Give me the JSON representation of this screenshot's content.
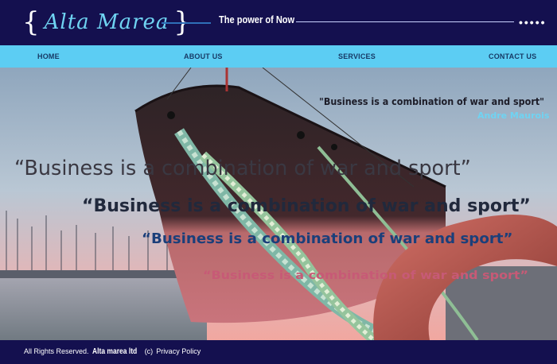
{
  "brand": {
    "brace_open": "{",
    "logo": "Alta Marea",
    "brace_close": "}",
    "tagline": "The power of Now",
    "dots": "•••••"
  },
  "nav": {
    "items": [
      {
        "label": "HOME"
      },
      {
        "label": "ABOUT US"
      },
      {
        "label": "SERVICES"
      },
      {
        "label": "CONTACT US"
      }
    ]
  },
  "hero": {
    "quote_small": "\"Business is a combination of war and sport\"",
    "author": "Andre Maurois",
    "quotes": [
      "“Business is a combination of war and sport”",
      "“Business is a combination of war and sport”",
      "“Business is a combination of war and sport”",
      "“Business is a combination of war and sport”"
    ]
  },
  "footer": {
    "rights": "All Rights Reserved.",
    "company": "Alta marea ltd",
    "copyright": "(c)",
    "privacy": "Privacy Policy"
  },
  "colors": {
    "header_bg": "#14104f",
    "nav_bg": "#5ccdf3",
    "logo": "#6fd3f2",
    "accent": "#6fd3f2"
  }
}
